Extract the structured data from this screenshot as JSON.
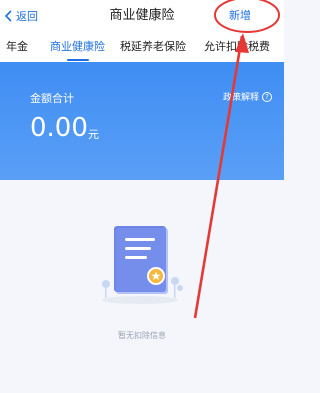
{
  "navbar": {
    "back_label": "返回",
    "title": "商业健康险",
    "add_label": "新增"
  },
  "tabs": [
    {
      "label": "年金",
      "active": false
    },
    {
      "label": "商业健康险",
      "active": true
    },
    {
      "label": "税延养老保险",
      "active": false
    },
    {
      "label": "允许扣除税费",
      "active": false
    }
  ],
  "summary": {
    "amount_label": "金额合计",
    "explain_label": "政策解释",
    "amount_value": "0.00",
    "amount_unit": "元"
  },
  "empty_state": {
    "message": "暂无扣除信息"
  },
  "colors": {
    "accent": "#1f6fe0",
    "hero_top": "#3f8df3",
    "annotation": "#e53935"
  }
}
